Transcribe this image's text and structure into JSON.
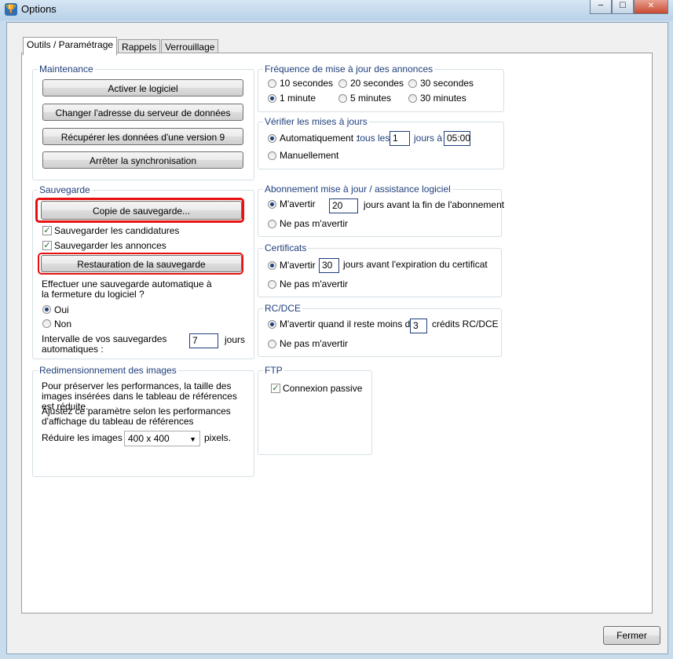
{
  "window": {
    "title": "Options",
    "minimize": "─",
    "maximize": "☐",
    "close": "✕",
    "icon_glyph": "🏆"
  },
  "tabs": [
    "Outils / Paramétrage",
    "Rappels",
    "Verrouillage"
  ],
  "maintenance": {
    "title": "Maintenance",
    "buttons": [
      "Activer le logiciel",
      "Changer l'adresse du serveur de données",
      "Récupérer les données d'une version 9",
      "Arrêter la synchronisation"
    ]
  },
  "sauvegarde": {
    "title": "Sauvegarde",
    "backup_button": "Copie de sauvegarde...",
    "check_candidatures": "Sauvegarder les candidatures",
    "check_annonces": "Sauvegarder les annonces",
    "restore_button": "Restauration de la sauvegarde",
    "auto_question": "Effectuer une sauvegarde automatique à la fermeture du logiciel ?",
    "oui": "Oui",
    "non": "Non",
    "interval_label": "Intervalle de vos sauvegardes automatiques :",
    "interval_value": "7",
    "interval_unit": "jours"
  },
  "images": {
    "title": "Redimensionnement des images",
    "text1": "Pour préserver les performances, la taille des images insérées dans le tableau de références est réduite.",
    "text2": "Ajustez ce paramètre selon les performances d'affichage du tableau de références",
    "reduce_label": "Réduire les images à",
    "reduce_value": "400 x 400",
    "reduce_unit": "pixels."
  },
  "frequence": {
    "title": "Fréquence de mise à jour des annonces",
    "options": [
      "10 secondes",
      "20 secondes",
      "30 secondes",
      "1 minute",
      "5 minutes",
      "30 minutes"
    ],
    "selected": "1 minute"
  },
  "verifier": {
    "title": "Vérifier les mises à jours",
    "auto_label": "Automatiquement :",
    "tous_les": "tous les",
    "days_value": "1",
    "jours_a": "jours à",
    "time_value": "05:00",
    "manual_label": "Manuellement"
  },
  "abonnement": {
    "title": "Abonnement mise à jour / assistance logiciel",
    "avertir": "M'avertir",
    "days_value": "20",
    "days_text": "jours avant la fin de l'abonnement",
    "no_warn": "Ne pas m'avertir"
  },
  "certificats": {
    "title": "Certificats",
    "avertir": "M'avertir",
    "days_value": "30",
    "days_text": "jours avant l'expiration du  certificat",
    "no_warn": "Ne pas m'avertir"
  },
  "rcdce": {
    "title": "RC/DCE",
    "avertir": "M'avertir quand il reste moins de",
    "credits_value": "3",
    "credits_text": "crédits RC/DCE",
    "no_warn": "Ne pas m'avertir"
  },
  "ftp": {
    "title": "FTP",
    "passive": "Connexion passive"
  },
  "footer": {
    "close_button": "Fermer"
  }
}
